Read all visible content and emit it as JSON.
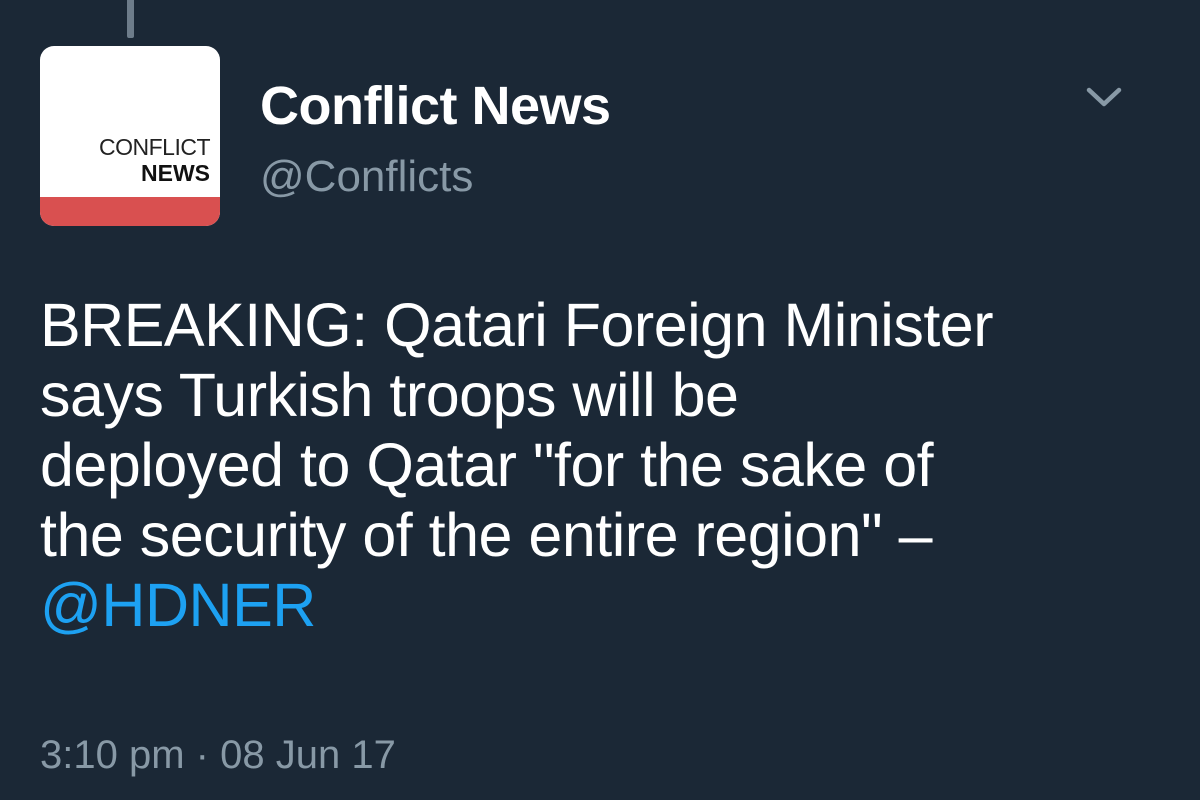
{
  "avatar": {
    "line1": "CONFLICT",
    "line2": "NEWS"
  },
  "author": {
    "display_name": "Conflict News",
    "handle": "@Conflicts"
  },
  "tweet": {
    "lines": [
      "BREAKING: Qatari Foreign Minister",
      "says Turkish troops will be",
      "deployed to Qatar \"for the sake of",
      "the security of the entire region\" –"
    ],
    "mention": "@HDNER"
  },
  "meta": {
    "time": "3:10 pm",
    "separator": "·",
    "date": "08 Jun 17"
  },
  "icons": {
    "menu": "chevron-down-icon"
  },
  "colors": {
    "background": "#1b2836",
    "accent": "#1da1f2",
    "muted": "#8899a6",
    "avatar_bar": "#d95050"
  }
}
